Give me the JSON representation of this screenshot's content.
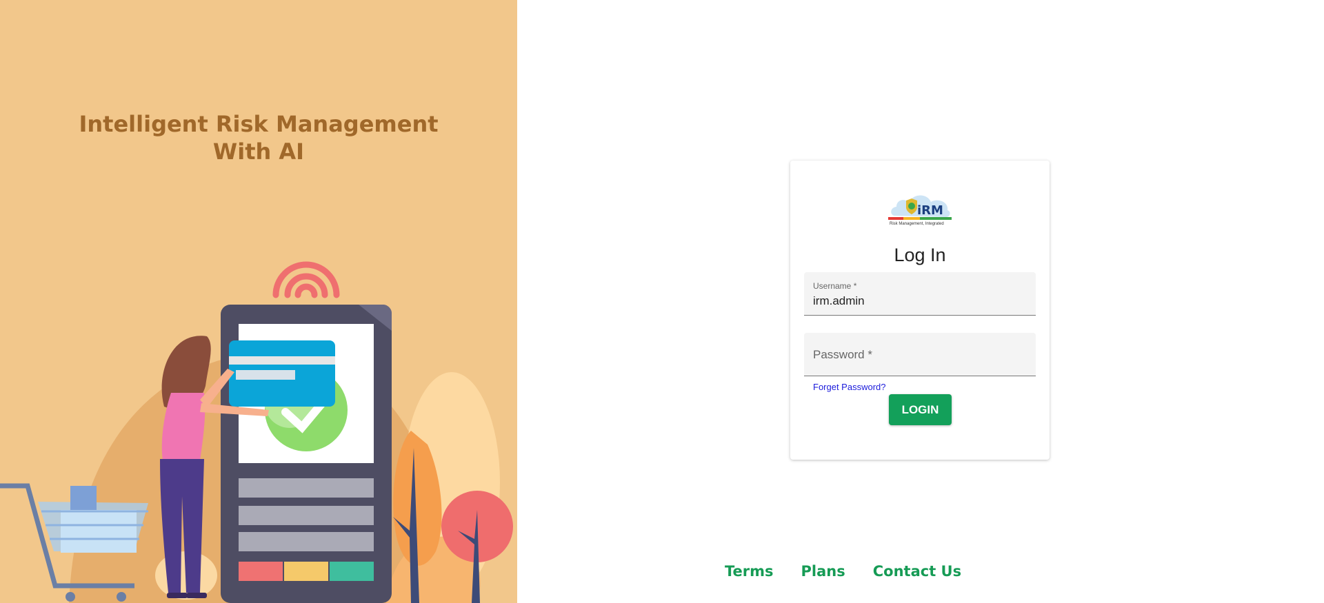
{
  "hero": {
    "headline_line1": "Intelligent Risk Management",
    "headline_line2": "With AI"
  },
  "login": {
    "logo_text": "iRM",
    "logo_tagline": "Risk Management, Integrated",
    "title": "Log In",
    "username_label": "Username *",
    "username_value": "irm.admin",
    "password_label": "Password *",
    "forget_link": "Forget Password?",
    "login_button": "LOGIN"
  },
  "footer": {
    "links": [
      "Terms",
      "Plans",
      "Contact Us"
    ]
  },
  "colors": {
    "hero_bg": "#f2c78b",
    "headline": "#a0682a",
    "accent_green": "#13a05a",
    "link_blue": "#1a1adb"
  }
}
